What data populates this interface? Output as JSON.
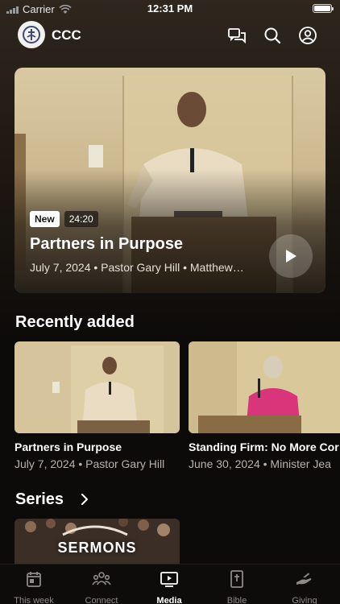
{
  "status_bar": {
    "carrier": "Carrier",
    "time": "12:31 PM"
  },
  "header": {
    "app_title": "CCC"
  },
  "hero": {
    "badge_new": "New",
    "duration": "24:20",
    "title": "Partners in Purpose",
    "meta": "July 7, 2024 • Pastor Gary Hill • Matthew…"
  },
  "recently_added": {
    "heading": "Recently added",
    "items": [
      {
        "title": "Partners in Purpose",
        "meta": "July 7, 2024 • Pastor Gary Hill"
      },
      {
        "title": "Standing Firm: No More Cor",
        "meta": "June 30, 2024 • Minister Jea"
      }
    ]
  },
  "series": {
    "heading": "Series",
    "thumb_text": "SERMONS"
  },
  "tabbar": {
    "tabs": [
      {
        "label": "This week",
        "icon": "calendar-icon",
        "active": false
      },
      {
        "label": "Connect",
        "icon": "people-icon",
        "active": false
      },
      {
        "label": "Media",
        "icon": "play-screen-icon",
        "active": true
      },
      {
        "label": "Bible",
        "icon": "bible-icon",
        "active": false
      },
      {
        "label": "Giving",
        "icon": "giving-hand-icon",
        "active": false
      }
    ]
  },
  "colors": {
    "background": "#0d0b09",
    "accent": "#ffffff",
    "muted": "#8e8a85"
  }
}
